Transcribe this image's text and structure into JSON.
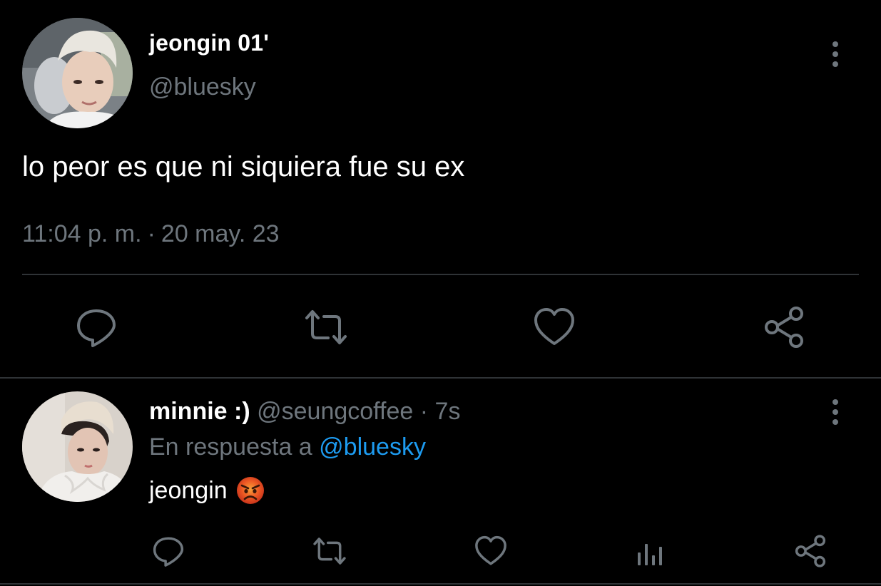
{
  "colors": {
    "background": "#000000",
    "primary_text": "#ffffff",
    "secondary_text": "#6e767d",
    "link": "#1d9bf0",
    "divider": "#2f3336"
  },
  "main_tweet": {
    "display_name": "jeongin 01'",
    "handle": "@bluesky",
    "text": "lo peor es que ni siquiera fue su ex",
    "time": "11:04 p. m.",
    "separator": "·",
    "date": "20 may. 23",
    "avatar": "profile-photo",
    "more_icon": "vertical-dots-icon",
    "actions": [
      "reply-icon",
      "retweet-icon",
      "like-icon",
      "share-icon"
    ]
  },
  "reply_tweet": {
    "display_name": "minnie :)",
    "handle": "@seungcoffee",
    "separator": "·",
    "time": "7s",
    "context_prefix": "En respuesta a",
    "context_mention": "@bluesky",
    "text": "jeongin",
    "emoji": "angry-face-emoji",
    "avatar": "profile-photo",
    "more_icon": "vertical-dots-icon",
    "actions": [
      "reply-icon",
      "retweet-icon",
      "like-icon",
      "analytics-icon",
      "share-icon"
    ]
  }
}
